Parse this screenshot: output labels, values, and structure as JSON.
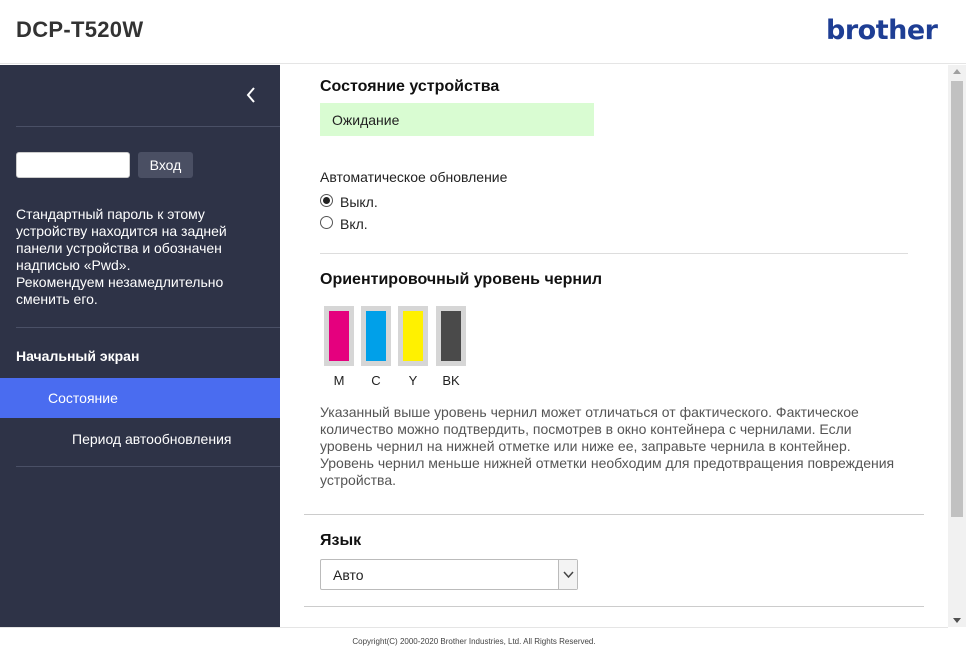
{
  "header": {
    "model": "DCP-T520W",
    "brand": "brother"
  },
  "sidebar": {
    "login_button": "Вход",
    "password_note": "Стандартный пароль к этому\nустройству находится на задней\nпанели устройства и обозначен\nнадписью «Pwd».\nРекомендуем незамедлительно\nсменить его.",
    "nav": {
      "home": "Начальный экран",
      "status": "Состояние",
      "refresh": "Период автообновления"
    }
  },
  "main": {
    "device_status": {
      "title": "Состояние устройства",
      "value": "Ожидание"
    },
    "auto_refresh": {
      "label": "Автоматическое обновление",
      "options": [
        "Выкл.",
        "Вкл."
      ],
      "selected": "Выкл."
    },
    "ink": {
      "title": "Ориентировочный уровень чернил",
      "cartridges": [
        {
          "label": "M",
          "color": "#e5007e",
          "level": 1.0
        },
        {
          "label": "C",
          "color": "#00a0e9",
          "level": 1.0
        },
        {
          "label": "Y",
          "color": "#fff100",
          "level": 1.0
        },
        {
          "label": "BK",
          "color": "#4a4a4a",
          "level": 1.0
        }
      ],
      "note": "Указанный выше уровень чернил может отличаться от фактического. Фактическое количество можно подтвердить, посмотрев в окно контейнера с чернилами. Если уровень чернил на нижней отметке или ниже ее, заправьте чернила в контейнер. Уровень чернил меньше нижней отметки необходим для предотвращения повреждения устройства."
    },
    "language": {
      "title": "Язык",
      "selected": "Авто"
    }
  },
  "footer": {
    "copyright": "Copyright(C) 2000-2020 Brother Industries, Ltd. All Rights Reserved."
  },
  "colors": {
    "sidebar_bg": "#2e3347",
    "active_nav": "#4a6cf0",
    "status_bg": "#d9fcd2",
    "brand": "#1e3e94"
  }
}
